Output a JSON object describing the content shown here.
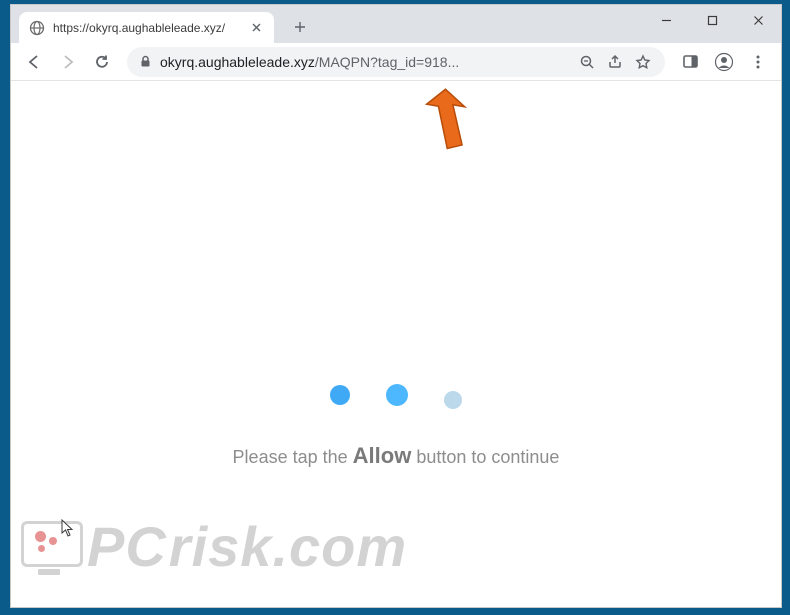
{
  "window": {
    "tab_title": "https://okyrq.aughableleade.xyz/",
    "url_domain": "okyrq.aughableleade.xyz",
    "url_path": "/MAQPN?tag_id=918..."
  },
  "page": {
    "instruction_pre": "Please tap the ",
    "instruction_bold": "Allow",
    "instruction_post": " button to continue"
  },
  "watermark": {
    "text_left": "PC",
    "text_right": "risk.com"
  },
  "colors": {
    "dot_primary": "#3fa9f5",
    "dot_faded": "#9ec9e2",
    "arrow": "#e86a1a"
  }
}
